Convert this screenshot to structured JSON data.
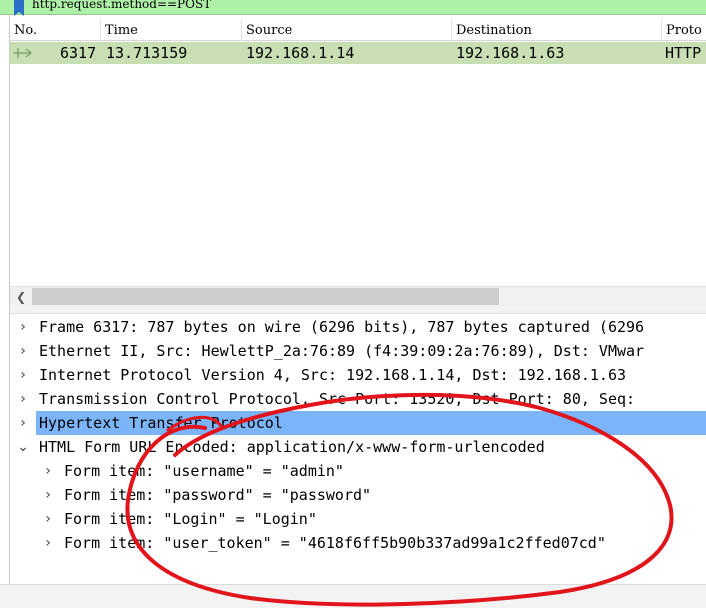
{
  "filter": {
    "text": "http.request.method==POST"
  },
  "packet_list": {
    "columns": [
      "No.",
      "Time",
      "Source",
      "Destination",
      "Proto"
    ],
    "rows": [
      {
        "no": "6317",
        "time": "13.713159",
        "source": "192.168.1.14",
        "destination": "192.168.1.63",
        "protocol": "HTTP"
      }
    ]
  },
  "details": {
    "items": [
      {
        "label": "Frame 6317: 787 bytes on wire (6296 bits), 787 bytes captured (6296",
        "expanded": false,
        "level": 0
      },
      {
        "label": "Ethernet II, Src: HewlettP_2a:76:89 (f4:39:09:2a:76:89), Dst: VMwar",
        "expanded": false,
        "level": 0
      },
      {
        "label": "Internet Protocol Version 4, Src: 192.168.1.14, Dst: 192.168.1.63",
        "expanded": false,
        "level": 0
      },
      {
        "label": "Transmission Control Protocol, Src Port: 13520, Dst Port: 80, Seq:",
        "expanded": false,
        "level": 0
      },
      {
        "label": "Hypertext Transfer Protocol",
        "expanded": false,
        "level": 0,
        "selected": true
      },
      {
        "label": "HTML Form URL Encoded: application/x-www-form-urlencoded",
        "expanded": true,
        "level": 0
      },
      {
        "label": "Form item: \"username\" = \"admin\"",
        "expanded": false,
        "level": 1
      },
      {
        "label": "Form item: \"password\" = \"password\"",
        "expanded": false,
        "level": 1
      },
      {
        "label": "Form item: \"Login\" = \"Login\"",
        "expanded": false,
        "level": 1
      },
      {
        "label": "Form item: \"user_token\" = \"4618f6ff5b90b337ad99a1c2ffed07cd\"",
        "expanded": false,
        "level": 1
      }
    ]
  },
  "colors": {
    "filter_bg": "#aef0a8",
    "packet_row_bg": "#c7dfb3",
    "selected_row_bg": "#7cb4f9",
    "annotation": "#e0141a"
  }
}
